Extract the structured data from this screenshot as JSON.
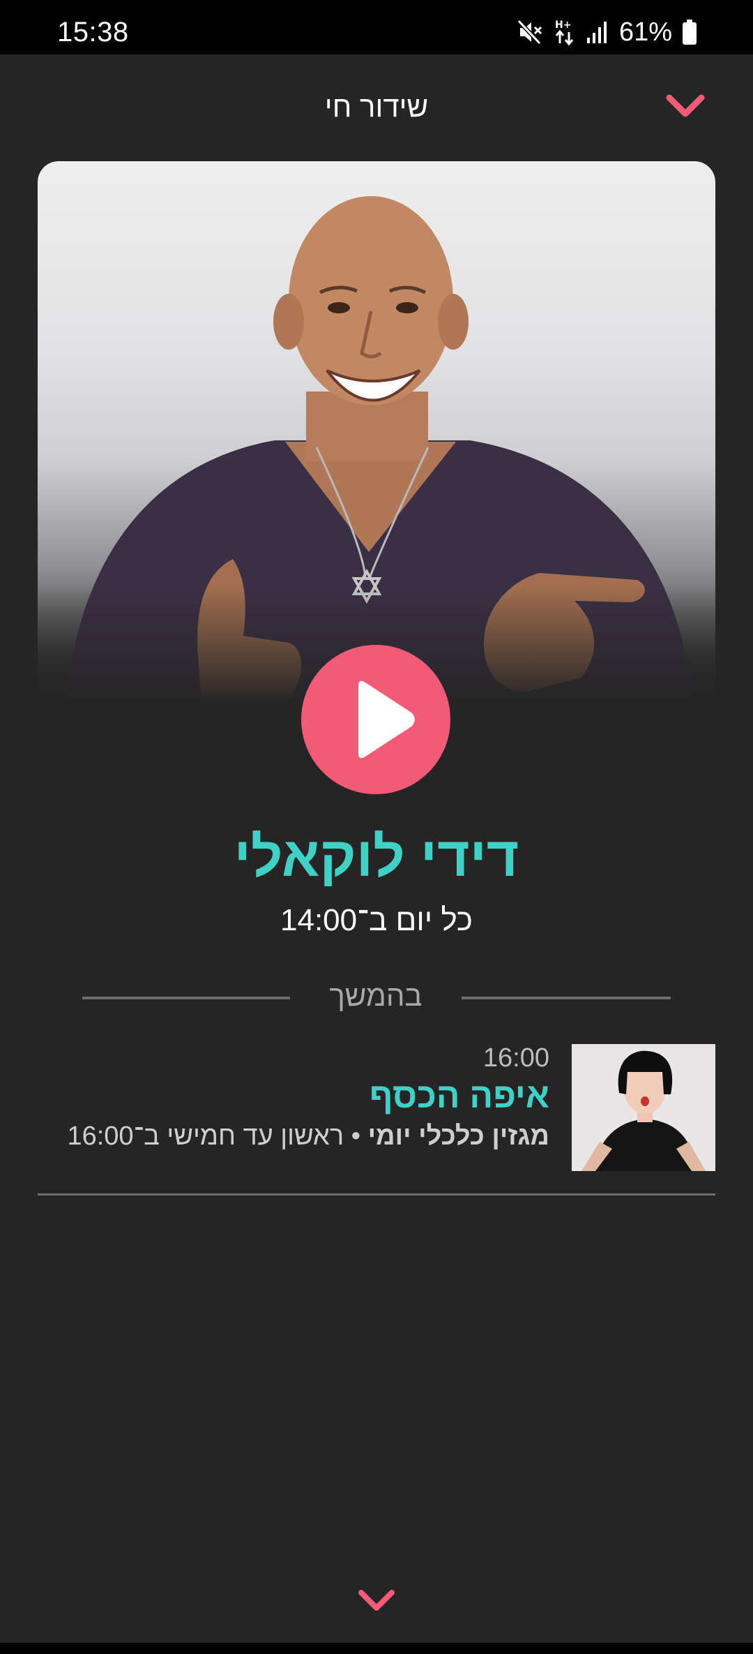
{
  "status_bar": {
    "time": "15:38",
    "battery": "61%",
    "icons": [
      "mute-icon",
      "data-hplus-icon",
      "signal-icon",
      "battery-icon"
    ]
  },
  "header": {
    "title": "שידור חי",
    "collapse_icon": "chevron-down-icon"
  },
  "now_playing": {
    "host_photo": "host-photo",
    "play_icon": "play-icon",
    "title": "דידי לוקאלי",
    "schedule": "כל יום ב־14:00"
  },
  "up_next": {
    "label": "בהמשך",
    "items": [
      {
        "time": "16:00",
        "title": "איפה הכסף",
        "desc_bold": "מגזין כלכלי יומי",
        "desc_rest": " • ראשון עד חמישי ב־16:00"
      }
    ]
  },
  "footer": {
    "expand_icon": "chevron-down-icon"
  },
  "colors": {
    "background": "#252525",
    "accent_pink": "#f25b76",
    "accent_teal": "#3fd0c6",
    "divider": "#6e6e6e"
  }
}
